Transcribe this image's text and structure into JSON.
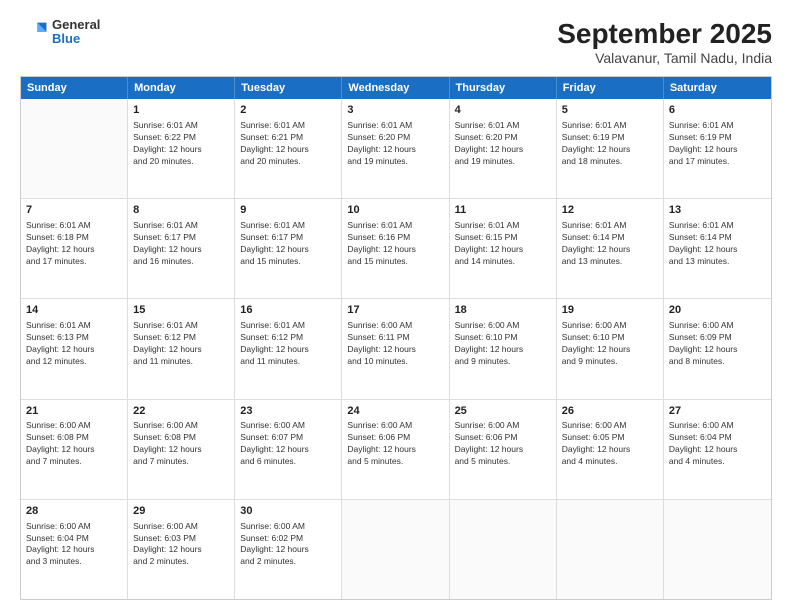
{
  "logo": {
    "line1": "General",
    "line2": "Blue"
  },
  "title": "September 2025",
  "subtitle": "Valavanur, Tamil Nadu, India",
  "days": [
    "Sunday",
    "Monday",
    "Tuesday",
    "Wednesday",
    "Thursday",
    "Friday",
    "Saturday"
  ],
  "weeks": [
    [
      {
        "day": "",
        "info": ""
      },
      {
        "day": "1",
        "info": "Sunrise: 6:01 AM\nSunset: 6:22 PM\nDaylight: 12 hours\nand 20 minutes."
      },
      {
        "day": "2",
        "info": "Sunrise: 6:01 AM\nSunset: 6:21 PM\nDaylight: 12 hours\nand 20 minutes."
      },
      {
        "day": "3",
        "info": "Sunrise: 6:01 AM\nSunset: 6:20 PM\nDaylight: 12 hours\nand 19 minutes."
      },
      {
        "day": "4",
        "info": "Sunrise: 6:01 AM\nSunset: 6:20 PM\nDaylight: 12 hours\nand 19 minutes."
      },
      {
        "day": "5",
        "info": "Sunrise: 6:01 AM\nSunset: 6:19 PM\nDaylight: 12 hours\nand 18 minutes."
      },
      {
        "day": "6",
        "info": "Sunrise: 6:01 AM\nSunset: 6:19 PM\nDaylight: 12 hours\nand 17 minutes."
      }
    ],
    [
      {
        "day": "7",
        "info": "Sunrise: 6:01 AM\nSunset: 6:18 PM\nDaylight: 12 hours\nand 17 minutes."
      },
      {
        "day": "8",
        "info": "Sunrise: 6:01 AM\nSunset: 6:17 PM\nDaylight: 12 hours\nand 16 minutes."
      },
      {
        "day": "9",
        "info": "Sunrise: 6:01 AM\nSunset: 6:17 PM\nDaylight: 12 hours\nand 15 minutes."
      },
      {
        "day": "10",
        "info": "Sunrise: 6:01 AM\nSunset: 6:16 PM\nDaylight: 12 hours\nand 15 minutes."
      },
      {
        "day": "11",
        "info": "Sunrise: 6:01 AM\nSunset: 6:15 PM\nDaylight: 12 hours\nand 14 minutes."
      },
      {
        "day": "12",
        "info": "Sunrise: 6:01 AM\nSunset: 6:14 PM\nDaylight: 12 hours\nand 13 minutes."
      },
      {
        "day": "13",
        "info": "Sunrise: 6:01 AM\nSunset: 6:14 PM\nDaylight: 12 hours\nand 13 minutes."
      }
    ],
    [
      {
        "day": "14",
        "info": "Sunrise: 6:01 AM\nSunset: 6:13 PM\nDaylight: 12 hours\nand 12 minutes."
      },
      {
        "day": "15",
        "info": "Sunrise: 6:01 AM\nSunset: 6:12 PM\nDaylight: 12 hours\nand 11 minutes."
      },
      {
        "day": "16",
        "info": "Sunrise: 6:01 AM\nSunset: 6:12 PM\nDaylight: 12 hours\nand 11 minutes."
      },
      {
        "day": "17",
        "info": "Sunrise: 6:00 AM\nSunset: 6:11 PM\nDaylight: 12 hours\nand 10 minutes."
      },
      {
        "day": "18",
        "info": "Sunrise: 6:00 AM\nSunset: 6:10 PM\nDaylight: 12 hours\nand 9 minutes."
      },
      {
        "day": "19",
        "info": "Sunrise: 6:00 AM\nSunset: 6:10 PM\nDaylight: 12 hours\nand 9 minutes."
      },
      {
        "day": "20",
        "info": "Sunrise: 6:00 AM\nSunset: 6:09 PM\nDaylight: 12 hours\nand 8 minutes."
      }
    ],
    [
      {
        "day": "21",
        "info": "Sunrise: 6:00 AM\nSunset: 6:08 PM\nDaylight: 12 hours\nand 7 minutes."
      },
      {
        "day": "22",
        "info": "Sunrise: 6:00 AM\nSunset: 6:08 PM\nDaylight: 12 hours\nand 7 minutes."
      },
      {
        "day": "23",
        "info": "Sunrise: 6:00 AM\nSunset: 6:07 PM\nDaylight: 12 hours\nand 6 minutes."
      },
      {
        "day": "24",
        "info": "Sunrise: 6:00 AM\nSunset: 6:06 PM\nDaylight: 12 hours\nand 5 minutes."
      },
      {
        "day": "25",
        "info": "Sunrise: 6:00 AM\nSunset: 6:06 PM\nDaylight: 12 hours\nand 5 minutes."
      },
      {
        "day": "26",
        "info": "Sunrise: 6:00 AM\nSunset: 6:05 PM\nDaylight: 12 hours\nand 4 minutes."
      },
      {
        "day": "27",
        "info": "Sunrise: 6:00 AM\nSunset: 6:04 PM\nDaylight: 12 hours\nand 4 minutes."
      }
    ],
    [
      {
        "day": "28",
        "info": "Sunrise: 6:00 AM\nSunset: 6:04 PM\nDaylight: 12 hours\nand 3 minutes."
      },
      {
        "day": "29",
        "info": "Sunrise: 6:00 AM\nSunset: 6:03 PM\nDaylight: 12 hours\nand 2 minutes."
      },
      {
        "day": "30",
        "info": "Sunrise: 6:00 AM\nSunset: 6:02 PM\nDaylight: 12 hours\nand 2 minutes."
      },
      {
        "day": "",
        "info": ""
      },
      {
        "day": "",
        "info": ""
      },
      {
        "day": "",
        "info": ""
      },
      {
        "day": "",
        "info": ""
      }
    ]
  ]
}
